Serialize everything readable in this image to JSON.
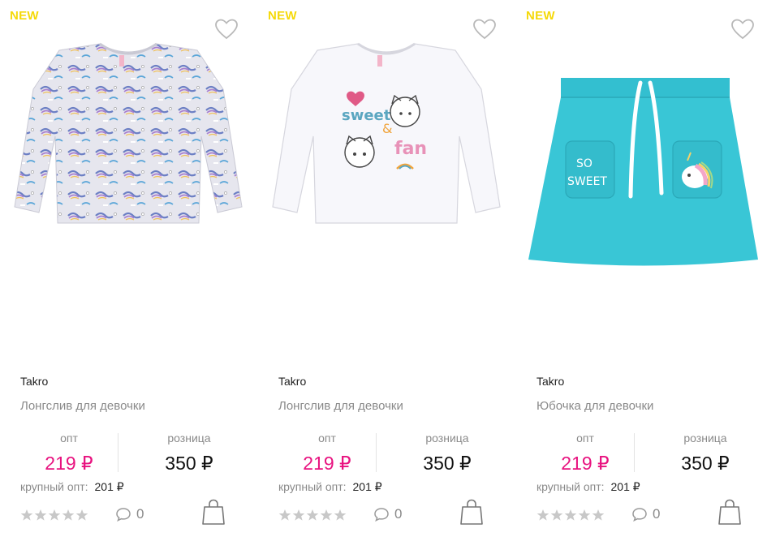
{
  "colors": {
    "badge": "#f5d90a",
    "price_opt": "#e8127f",
    "price_retail": "#111111",
    "muted": "#8a8a8a",
    "star": "#c8c8c8",
    "skirt": "#39c6d6"
  },
  "labels": {
    "opt": "опт",
    "retail": "розница",
    "wholesale": "крупный опт:"
  },
  "products": [
    {
      "badge": "NEW",
      "image": "longsleeve-unicorn-print",
      "brand": "Takro",
      "title": "Лонгслив для девочки",
      "price_opt": "219 ₽",
      "price_retail": "350 ₽",
      "price_wholesale": "201 ₽",
      "rating": 0,
      "comments": "0",
      "icons": {
        "favorite": "heart-icon",
        "comments": "comment-icon",
        "cart": "shopping-bag-icon"
      }
    },
    {
      "badge": "NEW",
      "image": "longsleeve-white-sweet-fan",
      "print_text_1": "sweet",
      "print_text_2": "fan",
      "brand": "Takro",
      "title": "Лонгслив для девочки",
      "price_opt": "219 ₽",
      "price_retail": "350 ₽",
      "price_wholesale": "201 ₽",
      "rating": 0,
      "comments": "0",
      "icons": {
        "favorite": "heart-icon",
        "comments": "comment-icon",
        "cart": "shopping-bag-icon"
      }
    },
    {
      "badge": "NEW",
      "image": "skirt-turquoise-so-sweet",
      "print_text_1": "SO",
      "print_text_2": "SWEET",
      "brand": "Takro",
      "title": "Юбочка для девочки",
      "price_opt": "219 ₽",
      "price_retail": "350 ₽",
      "price_wholesale": "201 ₽",
      "rating": 0,
      "comments": "0",
      "icons": {
        "favorite": "heart-icon",
        "comments": "comment-icon",
        "cart": "shopping-bag-icon"
      }
    }
  ]
}
